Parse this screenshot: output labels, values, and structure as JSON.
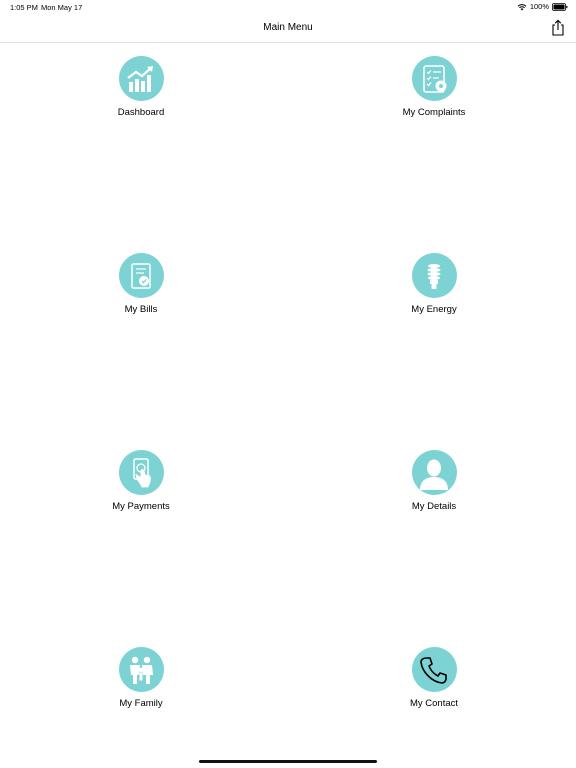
{
  "status_bar": {
    "time": "1:05 PM",
    "date": "Mon May 17",
    "battery": "100%"
  },
  "nav": {
    "title": "Main Menu",
    "share_icon": "share-icon"
  },
  "menu": {
    "items": [
      {
        "label": "Dashboard",
        "icon": "chart-icon"
      },
      {
        "label": "My Complaints",
        "icon": "checklist-gear-icon"
      },
      {
        "label": "My Bills",
        "icon": "bill-icon"
      },
      {
        "label": "My Energy",
        "icon": "lightbulb-icon"
      },
      {
        "label": "My Payments",
        "icon": "payment-hand-icon"
      },
      {
        "label": "My Details",
        "icon": "user-icon"
      },
      {
        "label": "My Family",
        "icon": "family-icon"
      },
      {
        "label": "My Contact",
        "icon": "phone-icon"
      }
    ]
  },
  "colors": {
    "accent": "#7dd3d3",
    "divider": "#e2e2e2"
  }
}
